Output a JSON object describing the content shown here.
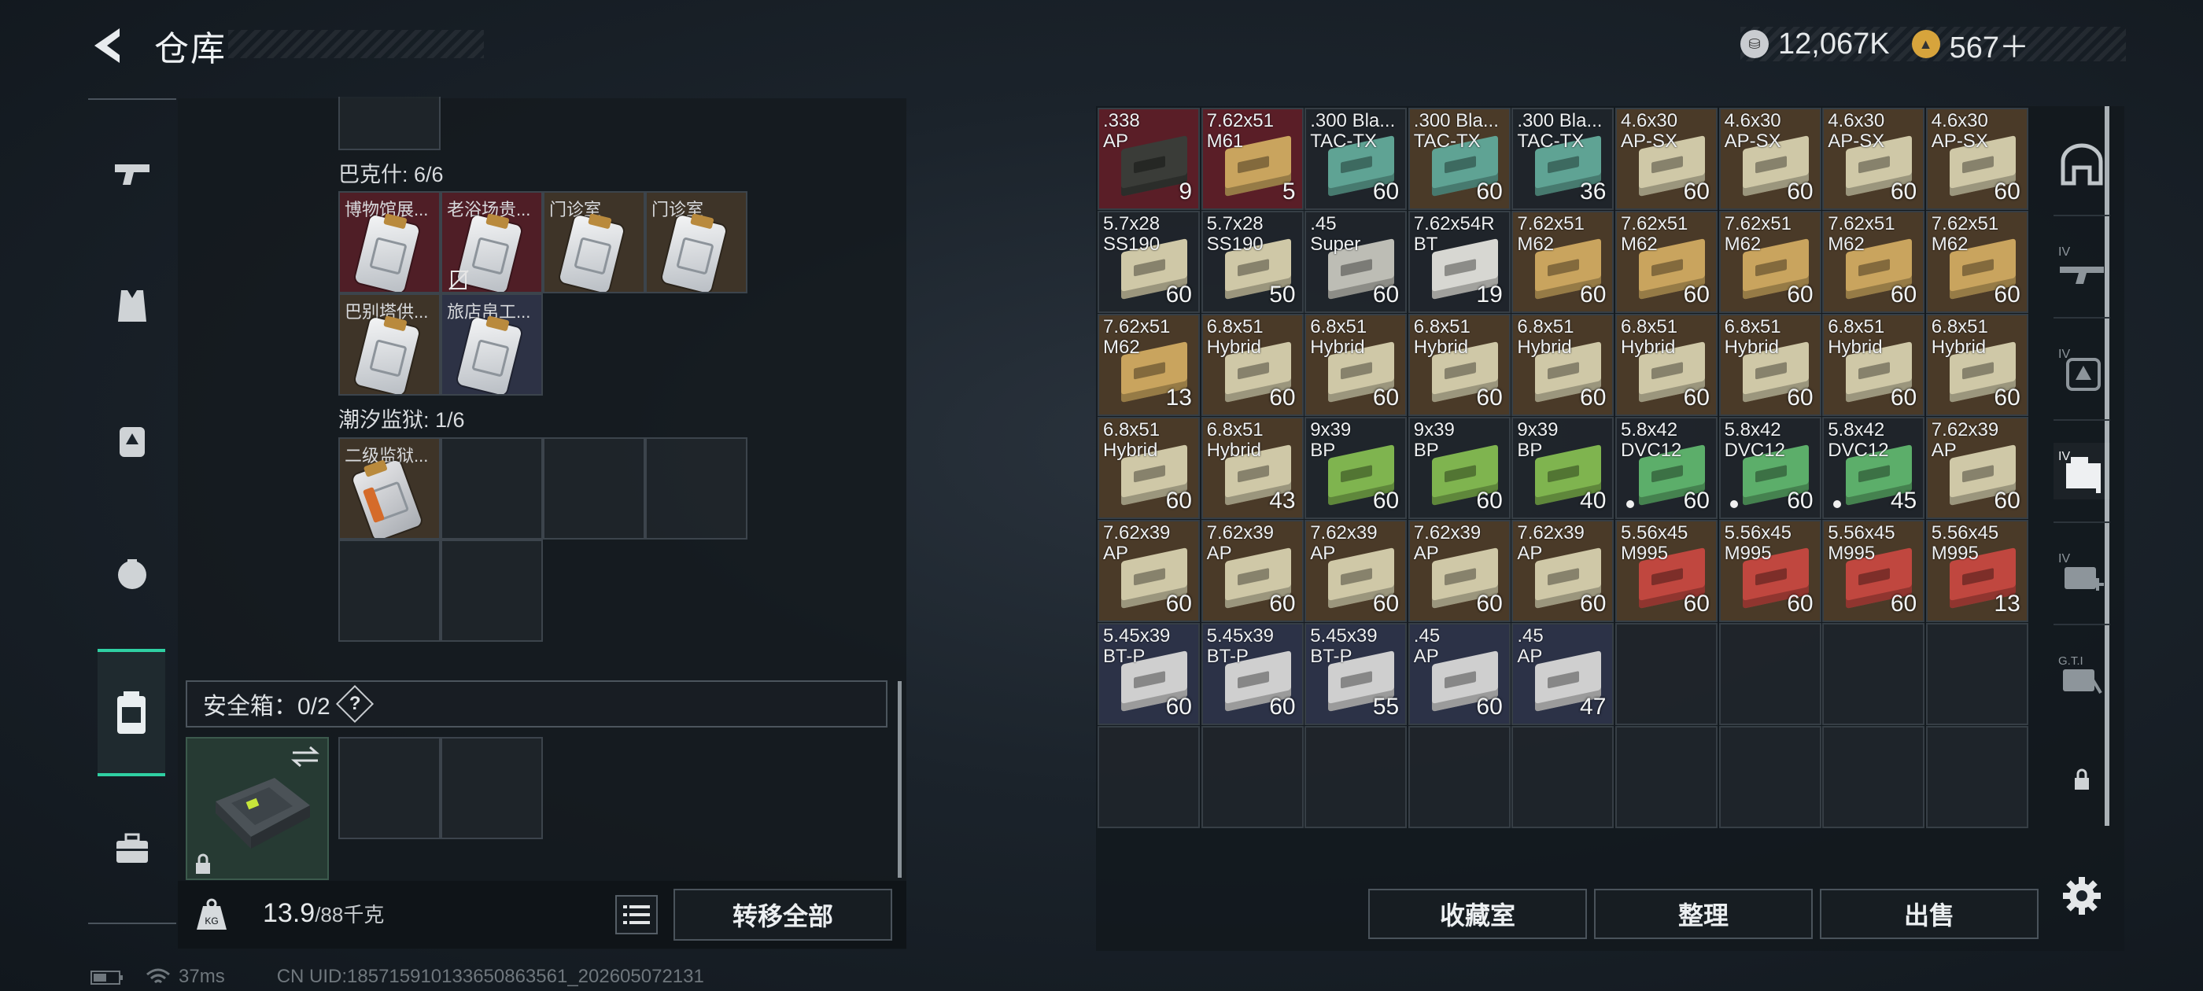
{
  "header": {
    "title": "仓库",
    "back_icon": "back-arrow-icon"
  },
  "currency": {
    "coins": "12,067K",
    "gems": "567＋"
  },
  "left": {
    "sections": [
      {
        "label": "巴克什: 6/6",
        "items": [
          "博物馆展...",
          "老浴场贵...",
          "门诊室",
          "门诊室",
          "巴别塔供...",
          "旅店帛工..."
        ]
      },
      {
        "label": "潮汐监狱: 1/6",
        "items": [
          "二级监狱..."
        ]
      }
    ],
    "safe": {
      "label": "安全箱：0/2",
      "help": "?"
    },
    "footer": {
      "weight": "13.9",
      "capacity": "/88千克",
      "transfer": "转移全部",
      "weight_unit": "KG"
    }
  },
  "stash": {
    "items": [
      {
        "cal": ".338\nAP",
        "count": "9",
        "color": "#3a3c38",
        "bg": "#5a1e27"
      },
      {
        "cal": "7.62x51\nM61",
        "count": "5",
        "color": "#c9a45e",
        "bg": "#5a1e27"
      },
      {
        "cal": ".300 Bla...\nTAC-TX",
        "count": "60",
        "color": "#5fa394",
        "bg": ""
      },
      {
        "cal": ".300 Bla...\nTAC-TX",
        "count": "60",
        "color": "#5fa394",
        "bg": "#4a3a28"
      },
      {
        "cal": ".300 Bla...\nTAC-TX",
        "count": "36",
        "color": "#5fa394",
        "bg": ""
      },
      {
        "cal": "4.6x30\nAP-SX",
        "count": "60",
        "color": "#cfc8a7",
        "bg": "#4a3a28"
      },
      {
        "cal": "4.6x30\nAP-SX",
        "count": "60",
        "color": "#cfc8a7",
        "bg": "#4a3a28"
      },
      {
        "cal": "4.6x30\nAP-SX",
        "count": "60",
        "color": "#cfc8a7",
        "bg": "#4a3a28"
      },
      {
        "cal": "4.6x30\nAP-SX",
        "count": "60",
        "color": "#cfc8a7",
        "bg": "#4a3a28"
      },
      {
        "cal": "5.7x28\nSS190",
        "count": "60",
        "color": "#cfc8a7",
        "bg": ""
      },
      {
        "cal": "5.7x28\nSS190",
        "count": "50",
        "color": "#cfc8a7",
        "bg": ""
      },
      {
        "cal": ".45\nSuper",
        "count": "60",
        "color": "#bdbdb5",
        "bg": ""
      },
      {
        "cal": "7.62x54R\nBT",
        "count": "19",
        "color": "#d7d7d2",
        "bg": ""
      },
      {
        "cal": "7.62x51\nM62",
        "count": "60",
        "color": "#c9a45e",
        "bg": "#4a3a28"
      },
      {
        "cal": "7.62x51\nM62",
        "count": "60",
        "color": "#c9a45e",
        "bg": "#4a3a28"
      },
      {
        "cal": "7.62x51\nM62",
        "count": "60",
        "color": "#c9a45e",
        "bg": "#4a3a28"
      },
      {
        "cal": "7.62x51\nM62",
        "count": "60",
        "color": "#c9a45e",
        "bg": "#4a3a28"
      },
      {
        "cal": "7.62x51\nM62",
        "count": "60",
        "color": "#c9a45e",
        "bg": "#4a3a28"
      },
      {
        "cal": "7.62x51\nM62",
        "count": "13",
        "color": "#c9a45e",
        "bg": "#4a3a28"
      },
      {
        "cal": "6.8x51\nHybrid",
        "count": "60",
        "color": "#cfc8a7",
        "bg": "#4a3a28"
      },
      {
        "cal": "6.8x51\nHybrid",
        "count": "60",
        "color": "#cfc8a7",
        "bg": "#4a3a28"
      },
      {
        "cal": "6.8x51\nHybrid",
        "count": "60",
        "color": "#cfc8a7",
        "bg": "#4a3a28"
      },
      {
        "cal": "6.8x51\nHybrid",
        "count": "60",
        "color": "#cfc8a7",
        "bg": "#4a3a28"
      },
      {
        "cal": "6.8x51\nHybrid",
        "count": "60",
        "color": "#cfc8a7",
        "bg": "#4a3a28"
      },
      {
        "cal": "6.8x51\nHybrid",
        "count": "60",
        "color": "#cfc8a7",
        "bg": "#4a3a28"
      },
      {
        "cal": "6.8x51\nHybrid",
        "count": "60",
        "color": "#cfc8a7",
        "bg": "#4a3a28"
      },
      {
        "cal": "6.8x51\nHybrid",
        "count": "60",
        "color": "#cfc8a7",
        "bg": "#4a3a28"
      },
      {
        "cal": "6.8x51\nHybrid",
        "count": "60",
        "color": "#cfc8a7",
        "bg": "#4a3a28"
      },
      {
        "cal": "6.8x51\nHybrid",
        "count": "43",
        "color": "#cfc8a7",
        "bg": "#4a3a28"
      },
      {
        "cal": "9x39\nBP",
        "count": "60",
        "color": "#7fb44f",
        "bg": ""
      },
      {
        "cal": "9x39\nBP",
        "count": "60",
        "color": "#7fb44f",
        "bg": ""
      },
      {
        "cal": "9x39\nBP",
        "count": "40",
        "color": "#7fb44f",
        "bg": ""
      },
      {
        "cal": "5.8x42\nDVC12",
        "count": "60",
        "color": "#5cae6a",
        "bg": "",
        "dot": true
      },
      {
        "cal": "5.8x42\nDVC12",
        "count": "60",
        "color": "#5cae6a",
        "bg": "",
        "dot": true
      },
      {
        "cal": "5.8x42\nDVC12",
        "count": "45",
        "color": "#5cae6a",
        "bg": "",
        "dot": true
      },
      {
        "cal": "7.62x39\nAP",
        "count": "60",
        "color": "#cfc8a7",
        "bg": "#4a3a28"
      },
      {
        "cal": "7.62x39\nAP",
        "count": "60",
        "color": "#cfc8a7",
        "bg": "#4a3a28"
      },
      {
        "cal": "7.62x39\nAP",
        "count": "60",
        "color": "#cfc8a7",
        "bg": "#4a3a28"
      },
      {
        "cal": "7.62x39\nAP",
        "count": "60",
        "color": "#cfc8a7",
        "bg": "#4a3a28"
      },
      {
        "cal": "7.62x39\nAP",
        "count": "60",
        "color": "#cfc8a7",
        "bg": "#4a3a28"
      },
      {
        "cal": "7.62x39\nAP",
        "count": "60",
        "color": "#cfc8a7",
        "bg": "#4a3a28"
      },
      {
        "cal": "5.56x45\nM995",
        "count": "60",
        "color": "#c0473f",
        "bg": "#4a3a28"
      },
      {
        "cal": "5.56x45\nM995",
        "count": "60",
        "color": "#c0473f",
        "bg": "#4a3a28"
      },
      {
        "cal": "5.56x45\nM995",
        "count": "60",
        "color": "#c0473f",
        "bg": "#4a3a28"
      },
      {
        "cal": "5.56x45\nM995",
        "count": "13",
        "color": "#c0473f",
        "bg": "#4a3a28"
      },
      {
        "cal": "5.45x39\nBT-P",
        "count": "60",
        "color": "#cfcfcf",
        "bg": "#2c3247"
      },
      {
        "cal": "5.45x39\nBT-P",
        "count": "60",
        "color": "#cfcfcf",
        "bg": "#2c3247"
      },
      {
        "cal": "5.45x39\nBT-P",
        "count": "55",
        "color": "#cfcfcf",
        "bg": "#2c3247"
      },
      {
        "cal": ".45\nAP",
        "count": "60",
        "color": "#cfcfcf",
        "bg": "#2c3247"
      },
      {
        "cal": ".45\nAP",
        "count": "47",
        "color": "#cfcfcf",
        "bg": "#2c3247"
      }
    ],
    "buttons": {
      "collection": "收藏室",
      "sort": "整理",
      "sell": "出售"
    }
  },
  "rightnav": [
    "base-icon",
    "weapon-loadout-icon",
    "armor-loadout-icon",
    "container-loadout-icon",
    "medkit-loadout-icon",
    "gti-loadout-icon",
    "lock-icon",
    "settings-icon"
  ],
  "status": {
    "ping": "37ms",
    "uid": "CN UID:185715910133650863561_202605072131"
  }
}
